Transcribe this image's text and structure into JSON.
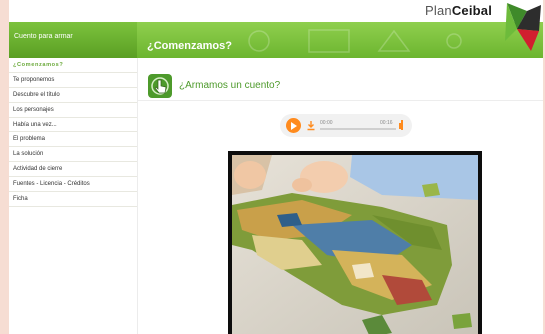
{
  "brand": {
    "plan": "Plan",
    "ceibal": "Ceibal"
  },
  "header": {
    "module_title": "Cuento para armar",
    "section_title": "¿Comenzamos?"
  },
  "sidebar": {
    "items": [
      {
        "label": "¿Comenzamos?",
        "active": true
      },
      {
        "label": "Te proponemos"
      },
      {
        "label": "Descubre el título"
      },
      {
        "label": "Los personajes"
      },
      {
        "label": "Había una vez..."
      },
      {
        "label": "El problema"
      },
      {
        "label": "La solución"
      },
      {
        "label": "Actividad de cierre"
      },
      {
        "label": "Fuentes - Licencia - Créditos"
      },
      {
        "label": "Ficha"
      }
    ]
  },
  "main": {
    "activity_title": "¿Armamos un cuento?",
    "player": {
      "current_time": "00:00",
      "total_time": "00:16",
      "progress": 0
    }
  },
  "colors": {
    "accent_green": "#4d9a2b",
    "header_green": "#7cc23d",
    "player_orange": "#ff8b1e",
    "page_bg": "#f6ddd3"
  },
  "icons": [
    "hand-pointer-icon",
    "play-icon",
    "download-icon",
    "volume-icon",
    "plan-ceibal-logo"
  ]
}
